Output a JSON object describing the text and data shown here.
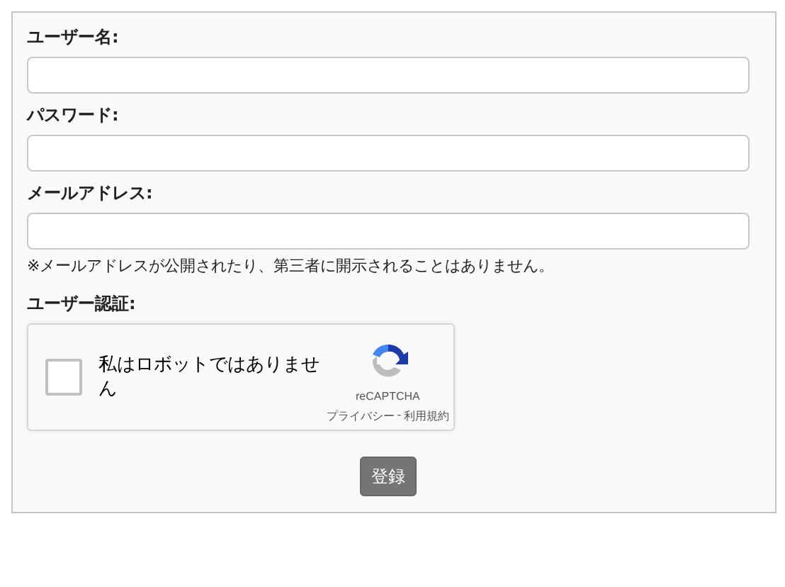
{
  "fields": [
    {
      "label": "ユーザー名:"
    },
    {
      "label": "パスワード:"
    },
    {
      "label": "メールアドレス:",
      "note": "※メールアドレスが公開されたり、第三者に開示されることはありません。"
    }
  ],
  "captcha": {
    "label": "ユーザー認証:",
    "checkbox_text": "私はロボットではありません",
    "checked": false,
    "brand": "reCAPTCHA",
    "privacy_link": "プライバシー",
    "separator": "-",
    "terms_link": "利用規約"
  },
  "submit_button": "登録"
}
